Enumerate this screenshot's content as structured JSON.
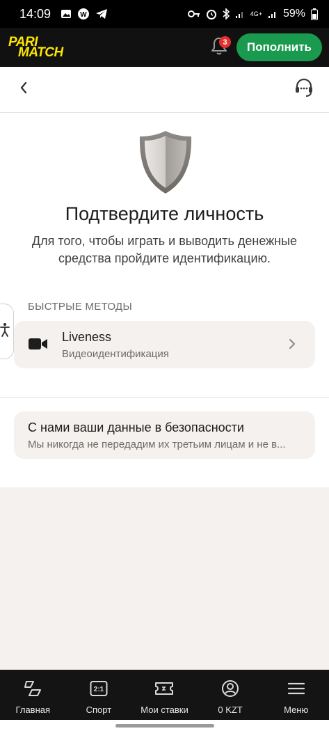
{
  "status_bar": {
    "time": "14:09",
    "battery": "59%",
    "network": "4G+"
  },
  "header": {
    "logo_line1": "PARI",
    "logo_line2": "MATCH",
    "notifications_count": "3",
    "topup_label": "Пополнить"
  },
  "page": {
    "title": "Подтвердите личность",
    "description": "Для того, чтобы играть и выводить денежные средства пройдите идентификацию."
  },
  "methods": {
    "section_label": "БЫСТРЫЕ МЕТОДЫ",
    "items": [
      {
        "title": "Liveness",
        "subtitle": "Видеоидентификация",
        "icon": "video-camera-icon"
      }
    ]
  },
  "security": {
    "title": "С нами ваши данные в безопасности",
    "subtitle": "Мы никогда не передадим их третьим лицам и не в..."
  },
  "bottom_nav": {
    "items": [
      {
        "label": "Главная",
        "icon": "home-icon"
      },
      {
        "label": "Спорт",
        "icon": "sport-icon"
      },
      {
        "label": "Мои ставки",
        "icon": "ticket-icon"
      },
      {
        "label": "0 KZT",
        "icon": "account-icon"
      },
      {
        "label": "Меню",
        "icon": "menu-icon"
      }
    ]
  },
  "colors": {
    "brand_yellow": "#ffe600",
    "accent_green": "#1a9a4e",
    "badge_red": "#e53030"
  }
}
